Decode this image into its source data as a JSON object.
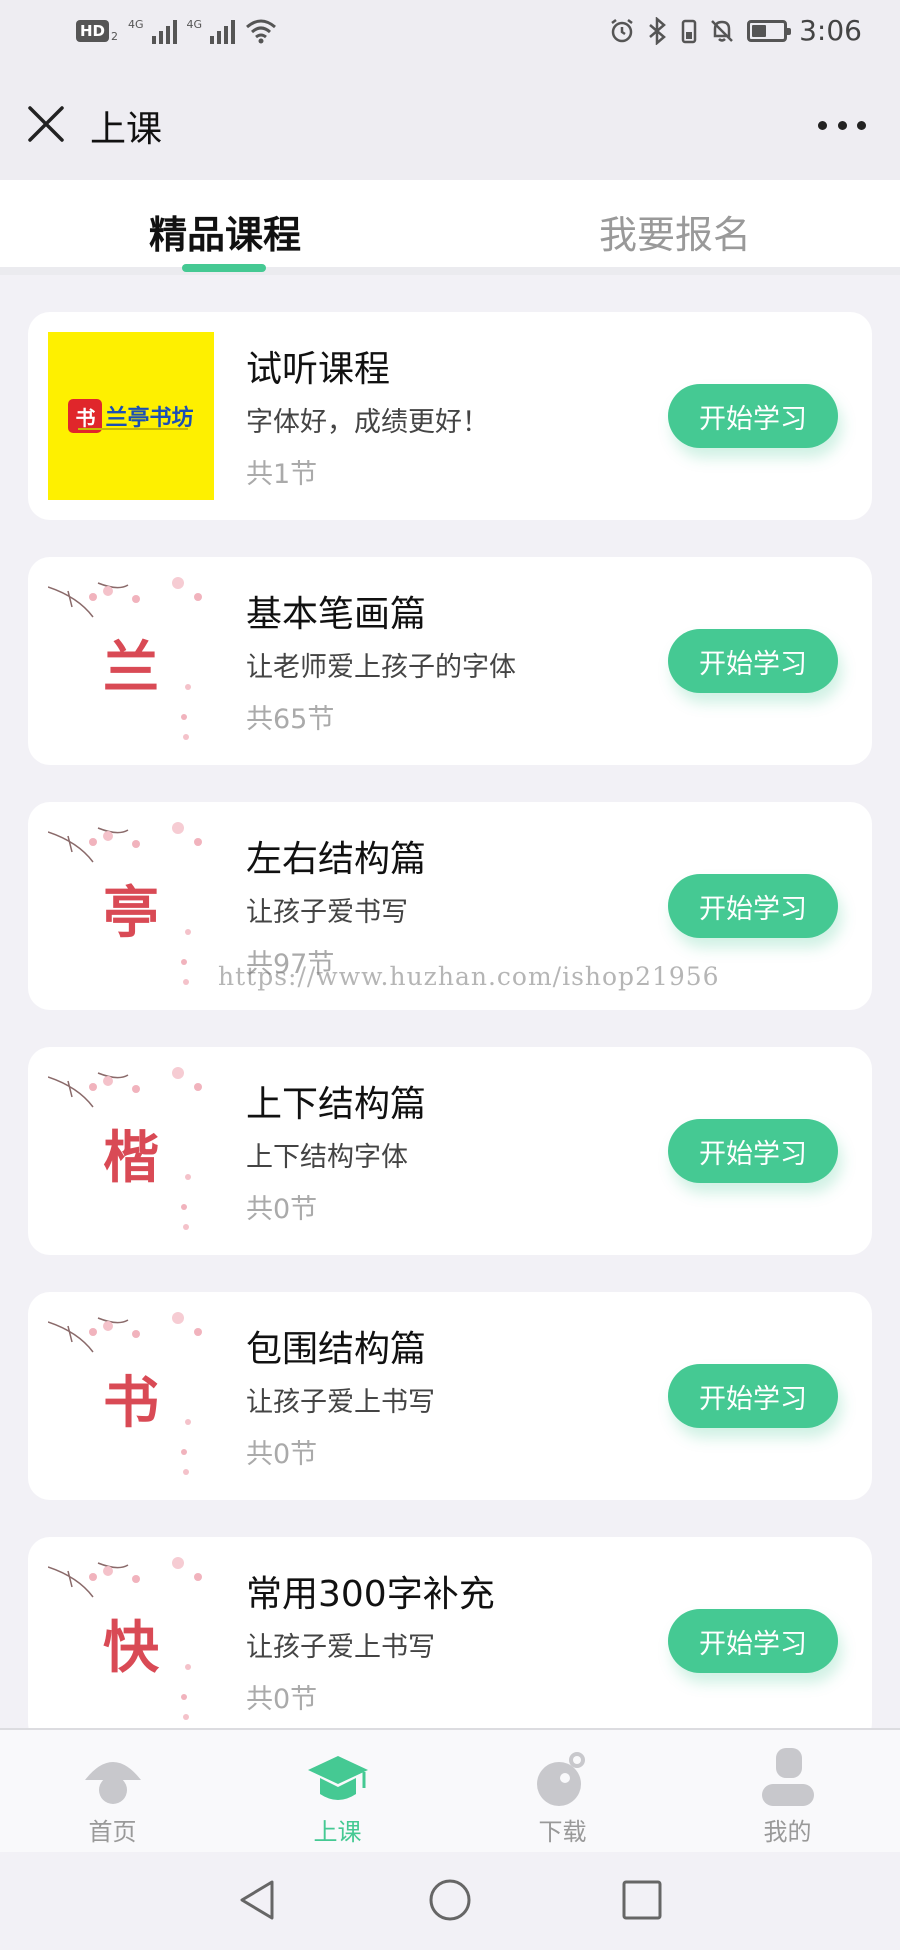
{
  "status_bar": {
    "hd_label": "HD",
    "hd_sub": "2",
    "network_1": "4G",
    "network_2": "4G",
    "time": "3:06",
    "battery_level": 0.45
  },
  "header": {
    "title": "上课"
  },
  "tabs": [
    {
      "label": "精品课程",
      "active": true
    },
    {
      "label": "我要报名",
      "active": false
    }
  ],
  "courses": [
    {
      "title": "试听课程",
      "desc": "字体好，成绩更好！",
      "count": "共1节",
      "button": "开始学习",
      "thumb_type": "logo",
      "thumb_text": "兰亭书坊",
      "thumb_seal": "书"
    },
    {
      "title": "基本笔画篇",
      "desc": "让老师爱上孩子的字体",
      "count": "共65节",
      "button": "开始学习",
      "thumb_type": "char",
      "thumb_text": "兰"
    },
    {
      "title": "左右结构篇",
      "desc": "让孩子爱书写",
      "count": "共97节",
      "button": "开始学习",
      "thumb_type": "char",
      "thumb_text": "亭"
    },
    {
      "title": "上下结构篇",
      "desc": "上下结构字体",
      "count": "共0节",
      "button": "开始学习",
      "thumb_type": "char",
      "thumb_text": "楷"
    },
    {
      "title": "包围结构篇",
      "desc": "让孩子爱上书写",
      "count": "共0节",
      "button": "开始学习",
      "thumb_type": "char",
      "thumb_text": "书"
    },
    {
      "title": "常用300字补充",
      "desc": "让孩子爱上书写",
      "count": "共0节",
      "button": "开始学习",
      "thumb_type": "char",
      "thumb_text": "快"
    }
  ],
  "watermark": "https://www.huzhan.com/ishop21956",
  "bottom_nav": [
    {
      "label": "首页",
      "icon": "home-icon",
      "active": false
    },
    {
      "label": "上课",
      "icon": "graduation-cap-icon",
      "active": true
    },
    {
      "label": "下载",
      "icon": "download-icon",
      "active": false
    },
    {
      "label": "我的",
      "icon": "profile-icon",
      "active": false
    }
  ],
  "colors": {
    "accent": "#45c993",
    "thumb_char": "#d94a55",
    "logo_bg": "#fef000"
  }
}
